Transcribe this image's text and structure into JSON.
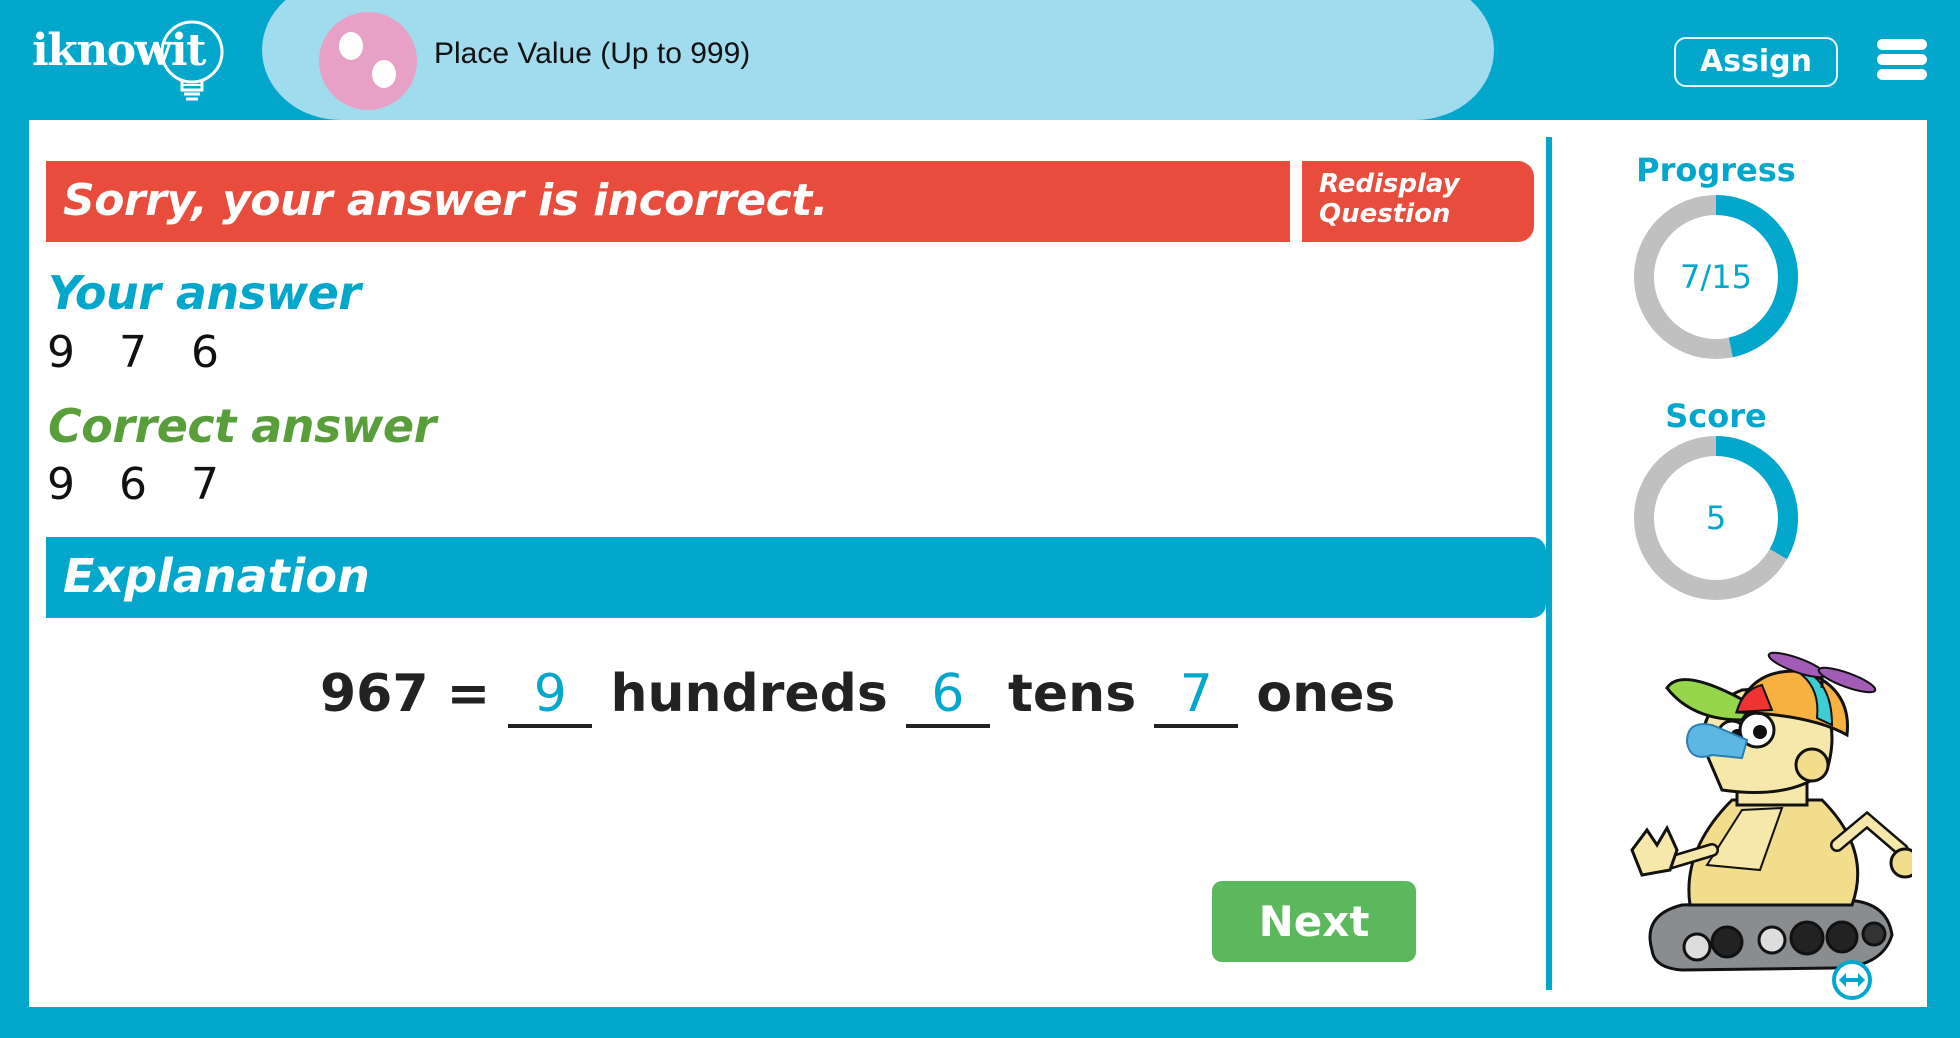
{
  "header": {
    "logo_text": "iknowit",
    "topic_title": "Place Value (Up to 999)",
    "assign_label": "Assign",
    "menu_icon": "hamburger-menu-icon",
    "topic_icon": "pink-dots-icon"
  },
  "feedback": {
    "message": "Sorry, your answer is incorrect.",
    "redisplay_label_line1": "Redisplay",
    "redisplay_label_line2": "Question"
  },
  "answers": {
    "your_label": "Your answer",
    "your_digits": [
      "9",
      "7",
      "6"
    ],
    "correct_label": "Correct answer",
    "correct_digits": [
      "9",
      "6",
      "7"
    ]
  },
  "explanation": {
    "title": "Explanation",
    "number": "967",
    "equals": "=",
    "hundreds_value": "9",
    "hundreds_label": "hundreds",
    "tens_value": "6",
    "tens_label": "tens",
    "ones_value": "7",
    "ones_label": "ones"
  },
  "next_label": "Next",
  "stats": {
    "progress_label": "Progress",
    "progress_text": "7/15",
    "progress_current": 7,
    "progress_total": 15,
    "score_label": "Score",
    "score_text": "5",
    "score_value": 5,
    "score_max": 15
  },
  "colors": {
    "brand_blue": "#03a7cc",
    "light_blue": "#a1dcee",
    "incorrect_red": "#e74c3c",
    "correct_green": "#5a9e3c",
    "next_green": "#5cb85c",
    "ring_gray": "#c0c0c0",
    "topic_pink": "#e7a1c6"
  },
  "mascot": {
    "icon": "robot-mascot-icon",
    "toggle_icon": "swap-arrows-icon"
  }
}
